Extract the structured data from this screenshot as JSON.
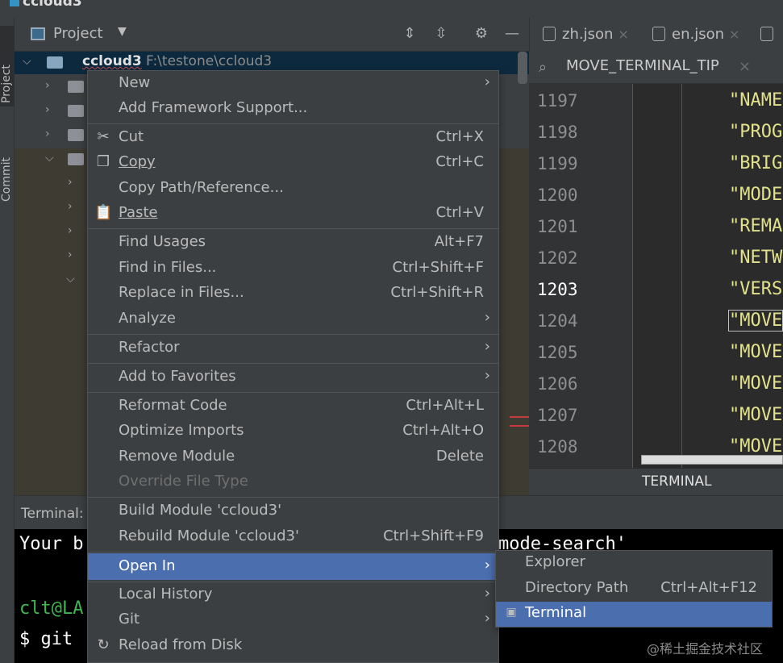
{
  "window": {
    "title": "ccloud3"
  },
  "left_tools": {
    "project_tab": "Project",
    "commit_tab": "Commit"
  },
  "project_panel": {
    "title": "Project",
    "root": {
      "name": "ccloud3",
      "path": "F:\\testone\\ccloud3"
    }
  },
  "editor": {
    "tabs": [
      {
        "label": "zh.json"
      },
      {
        "label": "en.json"
      }
    ],
    "search_text": "MOVE_TERMINAL_TIP",
    "lines": [
      {
        "num": "1197",
        "code": "\"NAME"
      },
      {
        "num": "1198",
        "code": "\"PROG"
      },
      {
        "num": "1199",
        "code": "\"BRIG"
      },
      {
        "num": "1200",
        "code": "\"MODE"
      },
      {
        "num": "1201",
        "code": "\"REMA"
      },
      {
        "num": "1202",
        "code": "\"NETW"
      },
      {
        "num": "1203",
        "code": "\"VERS"
      },
      {
        "num": "1204",
        "code": "\"MOVE"
      },
      {
        "num": "1205",
        "code": "\"MOVE"
      },
      {
        "num": "1206",
        "code": "\"MOVE"
      },
      {
        "num": "1207",
        "code": "\"MOVE"
      },
      {
        "num": "1208",
        "code": "\"MOVE"
      }
    ],
    "tooltip": "TERMINAL"
  },
  "terminal": {
    "label": "Terminal:",
    "line1_left": "Your b",
    "line1_right": "mode-search'",
    "line2": "clt@LA",
    "line3": "$ git "
  },
  "context_menu": {
    "new": "New",
    "add_framework": "Add Framework Support...",
    "cut": "Cut",
    "cut_sc": "Ctrl+X",
    "copy": "Copy",
    "copy_sc": "Ctrl+C",
    "copy_path": "Copy Path/Reference...",
    "paste": "Paste",
    "paste_sc": "Ctrl+V",
    "find_usages": "Find Usages",
    "find_usages_sc": "Alt+F7",
    "find_in_files": "Find in Files...",
    "find_in_files_sc": "Ctrl+Shift+F",
    "replace_in_files": "Replace in Files...",
    "replace_in_files_sc": "Ctrl+Shift+R",
    "analyze": "Analyze",
    "refactor": "Refactor",
    "add_favorites": "Add to Favorites",
    "reformat": "Reformat Code",
    "reformat_sc": "Ctrl+Alt+L",
    "optimize": "Optimize Imports",
    "optimize_sc": "Ctrl+Alt+O",
    "remove_module": "Remove Module",
    "remove_module_sc": "Delete",
    "override_file_type": "Override File Type",
    "build_module": "Build Module 'ccloud3'",
    "rebuild_module": "Rebuild Module 'ccloud3'",
    "rebuild_module_sc": "Ctrl+Shift+F9",
    "open_in": "Open In",
    "local_history": "Local History",
    "git": "Git",
    "reload": "Reload from Disk"
  },
  "submenu": {
    "explorer": "Explorer",
    "directory_path": "Directory Path",
    "directory_path_sc": "Ctrl+Alt+F12",
    "terminal": "Terminal"
  },
  "watermark": "@稀土掘金技术社区",
  "colors": {
    "selection": "#4b6eaf",
    "editor_highlight": "#0b0e7e",
    "string": "#e2e28c"
  }
}
